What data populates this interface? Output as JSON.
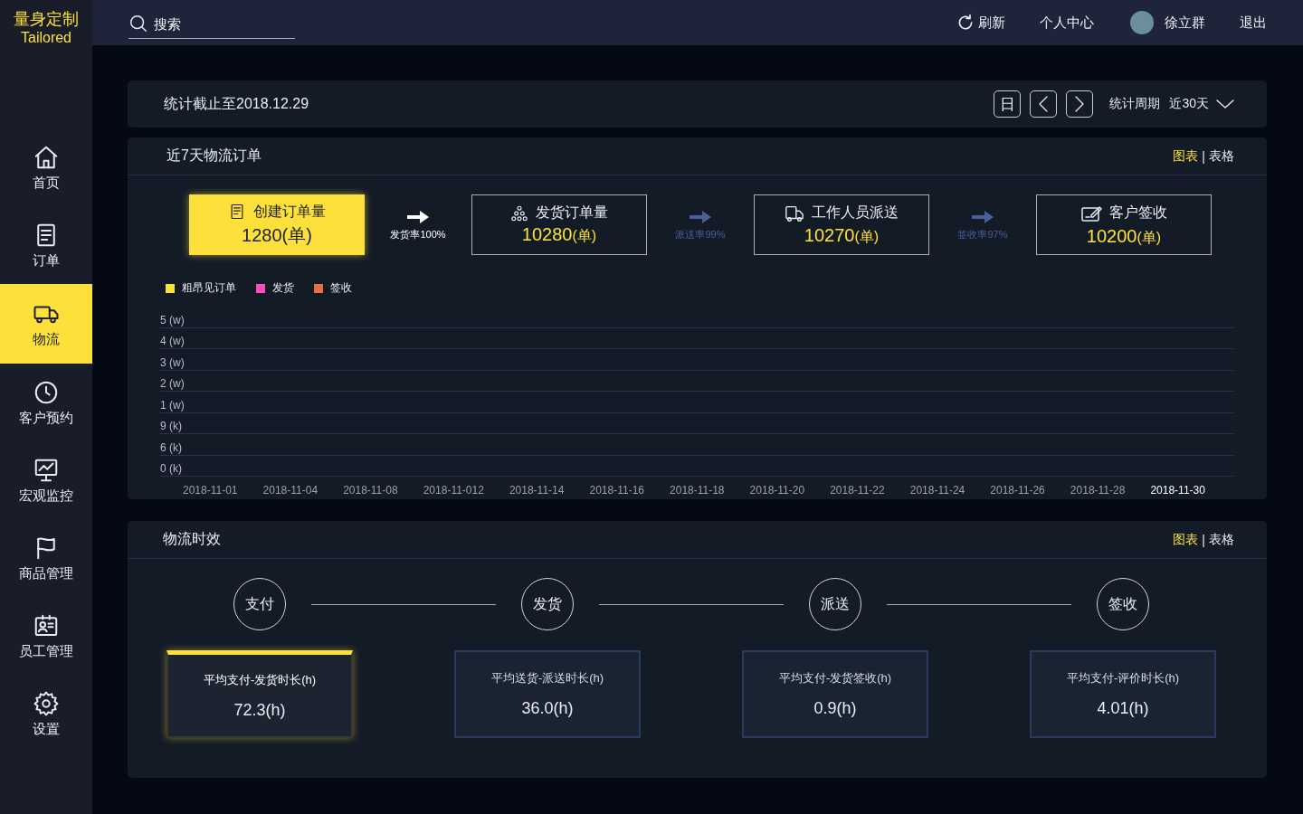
{
  "brand": {
    "title": "量身定制",
    "subtitle": "Tailored"
  },
  "search": {
    "placeholder": "搜索"
  },
  "topnav": {
    "refresh": "刷新",
    "profile": "个人中心",
    "user": "徐立群",
    "logout": "退出"
  },
  "sidebar": {
    "items": [
      {
        "label": "首页",
        "selected": false
      },
      {
        "label": "订单",
        "selected": false
      },
      {
        "label": "物流",
        "selected": true
      },
      {
        "label": "客户预约",
        "selected": false
      },
      {
        "label": "宏观监控",
        "selected": false
      },
      {
        "label": "商品管理",
        "selected": false
      },
      {
        "label": "员工管理",
        "selected": false
      },
      {
        "label": "设置",
        "selected": false
      }
    ]
  },
  "stats_bar": {
    "title": "统计截止至2018.12.29",
    "day_button": "日",
    "period_label": "统计周期",
    "period_value": "近30天"
  },
  "orders_panel": {
    "title": "近7天物流订单",
    "tab_separator": "|",
    "view_tabs": [
      {
        "label": "图表",
        "selected": true
      },
      {
        "label": "表格",
        "selected": false
      }
    ],
    "steps": [
      {
        "label": "创建订单量",
        "value": "1280",
        "unit": "(单)",
        "selected": true
      },
      {
        "label": "发货订单量",
        "value": "10280",
        "unit": "(单)",
        "selected": false
      },
      {
        "label": "工作人员派送",
        "value": "10270",
        "unit": "(单)",
        "selected": false
      },
      {
        "label": "客户签收",
        "value": "10200",
        "unit": "(单)",
        "selected": false
      }
    ],
    "rates": [
      {
        "label": "发货率100%",
        "active": true
      },
      {
        "label": "派送率99%",
        "active": false
      },
      {
        "label": "签收率97%",
        "active": false
      }
    ],
    "legend": [
      {
        "label": "粗昂见订单",
        "color": "#fde03a"
      },
      {
        "label": "发货",
        "color": "#f94dc0"
      },
      {
        "label": "签收",
        "color": "#e0743a"
      }
    ],
    "y_labels": [
      "5 (w)",
      "4 (w)",
      "3 (w)",
      "2 (w)",
      "1 (w)",
      "9 (k)",
      "6 (k)",
      "0 (k)"
    ],
    "x_labels": [
      {
        "label": "2018-11-01",
        "selected": false
      },
      {
        "label": "2018-11-04",
        "selected": false
      },
      {
        "label": "2018-11-08",
        "selected": false
      },
      {
        "label": "2018-11-012",
        "selected": false
      },
      {
        "label": "2018-11-14",
        "selected": false
      },
      {
        "label": "2018-11-16",
        "selected": false
      },
      {
        "label": "2018-11-18",
        "selected": false
      },
      {
        "label": "2018-11-20",
        "selected": false
      },
      {
        "label": "2018-11-22",
        "selected": false
      },
      {
        "label": "2018-11-24",
        "selected": false
      },
      {
        "label": "2018-11-26",
        "selected": false
      },
      {
        "label": "2018-11-28",
        "selected": false
      },
      {
        "label": "2018-11-30",
        "selected": true
      }
    ]
  },
  "timeliness_panel": {
    "title": "物流时效",
    "tab_separator": "|",
    "view_tabs": [
      {
        "label": "图表",
        "selected": true
      },
      {
        "label": "表格",
        "selected": false
      }
    ],
    "stages": [
      "支付",
      "发货",
      "派送",
      "签收"
    ],
    "metrics": [
      {
        "label": "平均支付-发货时长(h)",
        "value": "72.3(h)",
        "selected": true
      },
      {
        "label": "平均送货-派送时长(h)",
        "value": "36.0(h)",
        "selected": false
      },
      {
        "label": "平均支付-发货签收(h)",
        "value": "0.9(h)",
        "selected": false
      },
      {
        "label": "平均支付-评价时长(h)",
        "value": "4.01(h)",
        "selected": false
      }
    ]
  }
}
